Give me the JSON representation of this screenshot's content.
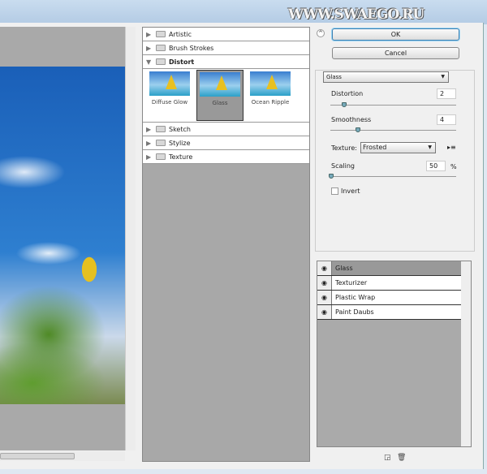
{
  "watermark": "WWW.SWAEGO.RU",
  "buttons": {
    "ok": "OK",
    "cancel": "Cancel"
  },
  "filter_categories": [
    {
      "label": "Artistic",
      "open": false
    },
    {
      "label": "Brush Strokes",
      "open": false
    },
    {
      "label": "Distort",
      "open": true,
      "filters": [
        "Diffuse Glow",
        "Glass",
        "Ocean Ripple"
      ],
      "selected": "Glass"
    },
    {
      "label": "Sketch",
      "open": false
    },
    {
      "label": "Stylize",
      "open": false
    },
    {
      "label": "Texture",
      "open": false
    }
  ],
  "settings": {
    "filter": "Glass",
    "distortion": {
      "label": "Distortion",
      "value": "2",
      "fraction": 0.1
    },
    "smoothness": {
      "label": "Smoothness",
      "value": "4",
      "fraction": 0.27
    },
    "texture": {
      "label": "Texture:",
      "value": "Frosted"
    },
    "scaling": {
      "label": "Scaling",
      "value": "50",
      "unit": "%",
      "fraction": 0.0
    },
    "invert": {
      "label": "Invert",
      "checked": false
    }
  },
  "layers": [
    "Glass",
    "Texturizer",
    "Plastic Wrap",
    "Paint Daubs"
  ]
}
